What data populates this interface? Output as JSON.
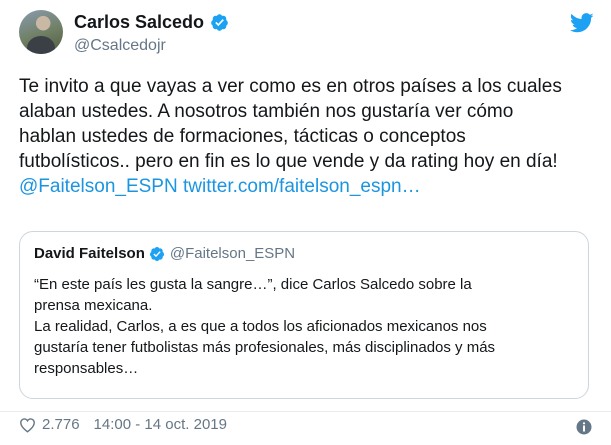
{
  "author": {
    "name": "Carlos Salcedo",
    "handle": "@Csalcedojr",
    "verified_icon": "verified-badge-icon",
    "avatar": "profile-photo"
  },
  "brand_icon": "twitter-bird-icon",
  "tweet": {
    "text_line1": "Te invito a que vayas a ver como es en otros países a los cuales",
    "text_line2": "alaban ustedes. A nosotros también nos gustaría ver cómo",
    "text_line3": "hablan ustedes de formaciones, tácticas o conceptos",
    "text_line4": "futbolísticos.. pero en fin es lo que vende y da rating hoy en día!",
    "mention": "@Faitelson_ESPN",
    "url": "twitter.com/faitelson_espn…"
  },
  "quoted": {
    "name": "David Faitelson",
    "handle": "@Faitelson_ESPN",
    "line1": "“En este país les gusta la sangre…”, dice Carlos Salcedo sobre la",
    "line2": "prensa mexicana.",
    "line3": "La realidad, Carlos, a es que a todos los aficionados mexicanos nos",
    "line4": "gustaría tener futbolistas más profesionales, más disciplinados y más",
    "line5": "responsables…"
  },
  "footer": {
    "likes": "2.776",
    "timestamp": "14:00 - 14 oct. 2019",
    "like_icon": "heart-icon",
    "info_icon": "info-icon"
  },
  "colors": {
    "link": "#1b95e0",
    "verified": "#1da1f2",
    "secondary_text": "#657786",
    "border": "#ccd6dd"
  }
}
